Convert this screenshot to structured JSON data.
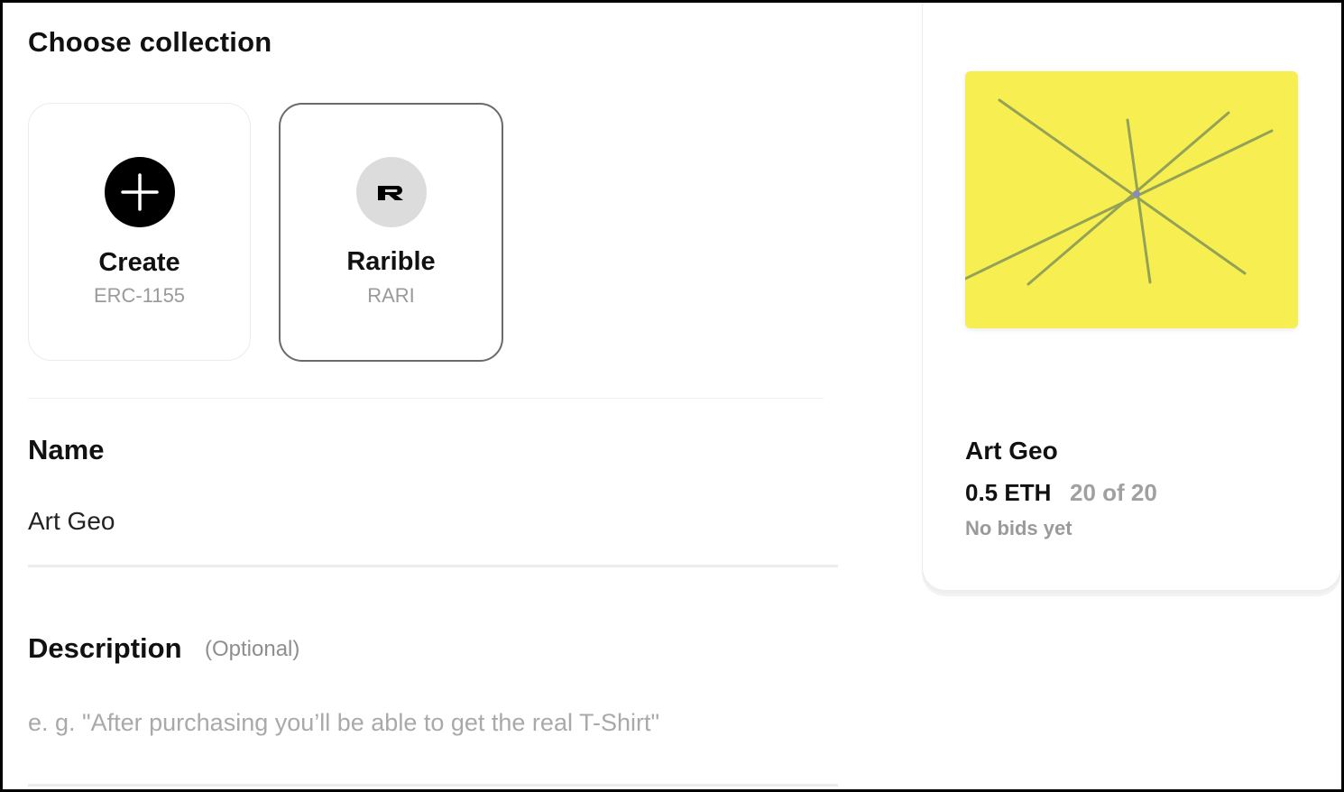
{
  "choose_collection": {
    "title": "Choose collection",
    "options": [
      {
        "title": "Create",
        "subtitle": "ERC-1155",
        "icon": "plus-icon",
        "selected": false
      },
      {
        "title": "Rarible",
        "subtitle": "RARI",
        "icon": "rarible-logo-icon",
        "selected": true
      }
    ]
  },
  "name_field": {
    "label": "Name",
    "value": "Art Geo"
  },
  "description_field": {
    "label": "Description",
    "optional_hint": "(Optional)",
    "value": "",
    "placeholder": "e. g. \"After purchasing you’ll be able to get the real T-Shirt\""
  },
  "preview": {
    "art_background": "#f7ef52",
    "art_line_color": "#8a9a56",
    "name": "Art Geo",
    "price": "0.5 ETH",
    "count": "20 of 20",
    "bids": "No bids yet"
  },
  "colors": {
    "selected_border": "#6a6a6a",
    "muted_text": "#9a9a9a"
  }
}
